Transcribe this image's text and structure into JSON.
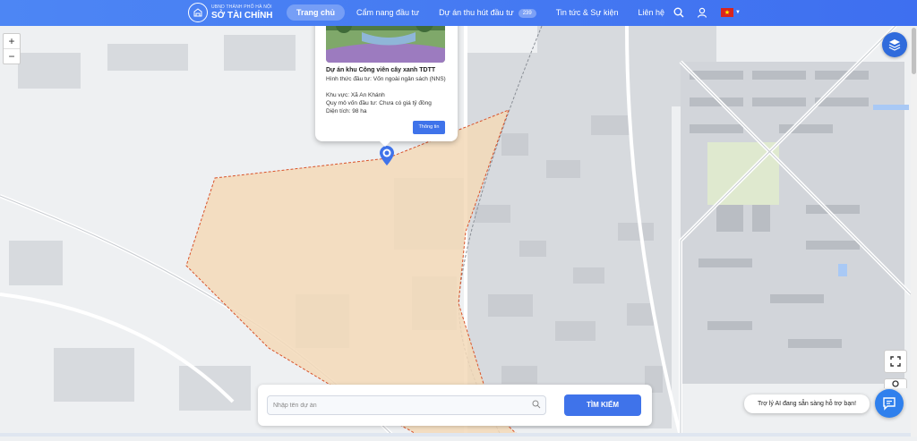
{
  "header": {
    "logo_sub": "UBND THÀNH PHỐ HÀ NỘI",
    "logo_main": "SỞ TÀI CHÍNH",
    "nav": [
      {
        "label": "Trang chủ",
        "active": true
      },
      {
        "label": "Cẩm nang đầu tư"
      },
      {
        "label": "Dự án thu hút đầu tư",
        "badge": "239"
      },
      {
        "label": "Tin tức & Sự kiện"
      },
      {
        "label": "Liên hệ"
      }
    ],
    "icons": [
      "search-icon",
      "user-icon",
      "vietnam-flag-icon",
      "chevron-down-icon"
    ]
  },
  "map": {
    "zoom_in": "+",
    "zoom_out": "−",
    "area_fill": "#f3d9b8",
    "area_border": "#d9532b",
    "marker_color": "#3f73ea"
  },
  "popup": {
    "title": "Dự án khu Công viên cây xanh TDTT",
    "lines": [
      "Hình thức đầu tư: Vốn ngoài ngân sách (NNS)",
      "Khu vực: Xã An Khánh",
      "Quy mô vốn đầu tư: Chưa có giá tỷ đồng",
      "Diện tích: 98 ha"
    ],
    "button": "Thông tin"
  },
  "search": {
    "placeholder": "Nhập tên dự án",
    "value": "",
    "button": "TÌM KIẾM"
  },
  "assistant": {
    "bubble": "Trợ lý AI đang sẵn sàng hỗ trợ bạn!"
  },
  "colors": {
    "primary": "#3f73ea",
    "header": "#4d86f4"
  }
}
